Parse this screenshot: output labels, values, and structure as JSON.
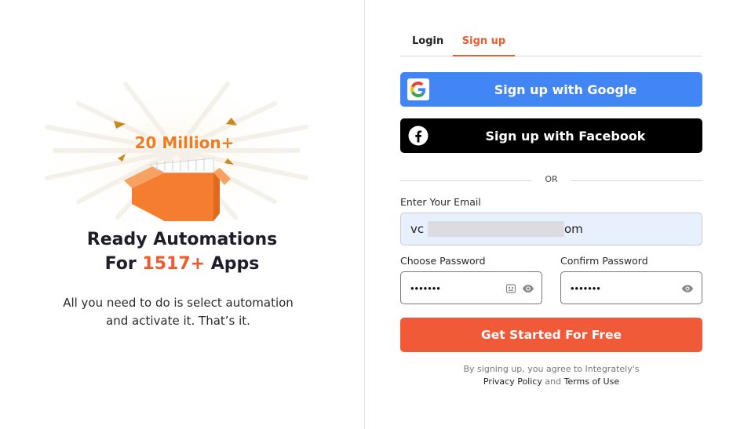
{
  "illustration": {
    "badge_text": "20 Million+",
    "colors": {
      "box": "#f47d30",
      "box_dark": "#e06a1c",
      "badge": "#f07a1e"
    }
  },
  "headline": {
    "line1": "Ready Automations",
    "line2_prefix": "For ",
    "line2_accent": "1517+",
    "line2_suffix": " Apps"
  },
  "subtext": {
    "line1": "All you need to do is select automation",
    "line2": "and activate it. That’s it."
  },
  "tabs": {
    "login": "Login",
    "signup": "Sign up",
    "active": "signup"
  },
  "social": {
    "google_label": "Sign up with Google",
    "facebook_label": "Sign up with Facebook",
    "google_color": "#4285f4",
    "facebook_color": "#000000"
  },
  "divider": {
    "or_text": "OR"
  },
  "form": {
    "email_label": "Enter Your Email",
    "email_value_start": "vc",
    "email_value_end": "om",
    "choose_password_label": "Choose Password",
    "choose_password_value": "•••••••",
    "confirm_password_label": "Confirm Password",
    "confirm_password_value": "•••••••",
    "submit_label": "Get Started For Free",
    "submit_color": "#f05a38"
  },
  "terms": {
    "line1": "By signing up, you agree to Integrately's",
    "privacy": "Privacy Policy",
    "and": " and ",
    "tos": "Terms of Use"
  },
  "icons": [
    "google-icon",
    "facebook-icon",
    "keyboard-icon",
    "eye-icon",
    "eye-icon"
  ]
}
